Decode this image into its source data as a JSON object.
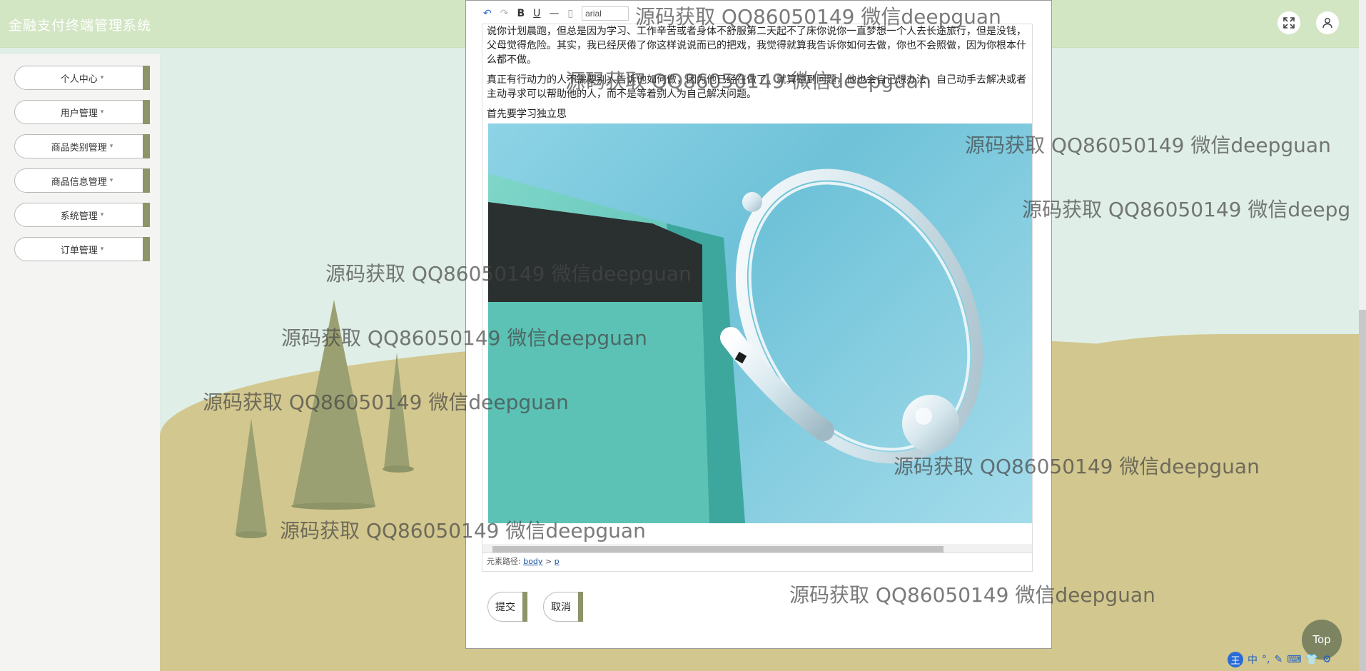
{
  "header": {
    "title": "金融支付终端管理系统",
    "fullscreen_icon": "expand-icon",
    "user_icon": "user-icon"
  },
  "sidebar": {
    "items": [
      {
        "label": "个人中心"
      },
      {
        "label": "用户管理"
      },
      {
        "label": "商品类别管理"
      },
      {
        "label": "商品信息管理"
      },
      {
        "label": "系统管理"
      },
      {
        "label": "订单管理"
      }
    ],
    "caret": "▾"
  },
  "editor": {
    "font_value": "arial",
    "paragraphs": [
      "说你计划晨跑，但总是因为学习、工作辛苦或者身体不舒服第二天起不了床你说你一直梦想一个人去长途旅行，但是没钱，父母觉得危险。其实，我已经厌倦了你这样说说而已的把戏，我觉得就算我告诉你如何去做，你也不会照做，因为你根本什么都不做。",
      "真正有行动力的人不需要别人告诉他如何做，因为他已经在做了。就算碰到问题，他也会自己想办法，自己动手去解决或者主动寻求可以帮助他的人，而不是等着别人为自己解决问题。",
      "首先要学习独立思"
    ],
    "path_label": "元素路径:",
    "path_body": "body",
    "path_sep": ">",
    "path_p": "p"
  },
  "buttons": {
    "submit": "提交",
    "cancel": "取消"
  },
  "top_button": "Top",
  "watermark": "源码获取 QQ86050149 微信deepguan",
  "watermark_cut": "源码获取 QQ86050149 微信deepg",
  "ime": {
    "logo": "王",
    "lang": "中"
  }
}
